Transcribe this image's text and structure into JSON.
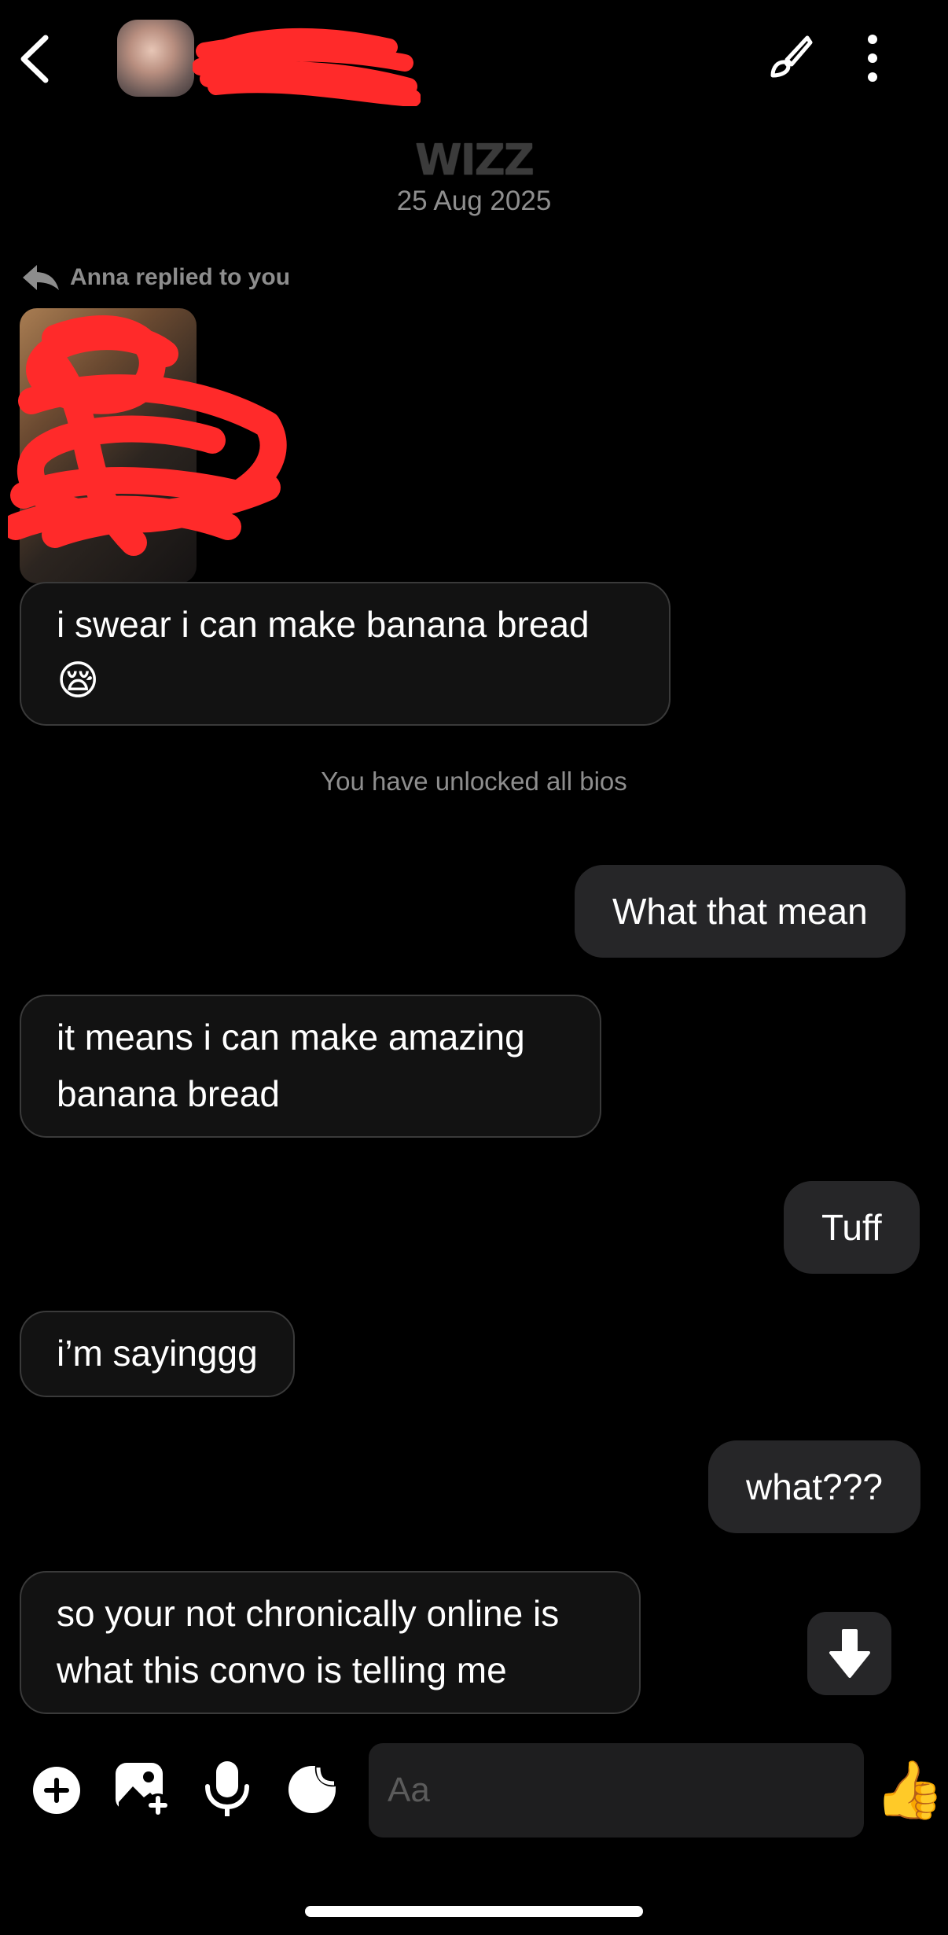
{
  "header": {
    "back_icon": "chevron-left-icon",
    "brush_icon": "paintbrush-icon",
    "more_icon": "vertical-ellipsis-icon"
  },
  "brand": "WIZZ",
  "date": "25 Aug 2025",
  "reply_note": "Anna replied to you",
  "messages": [
    {
      "side": "in",
      "text": "i swear i can make banana bread"
    },
    {
      "side": "system",
      "text": "You have unlocked all bios"
    },
    {
      "side": "out",
      "text": "What that mean"
    },
    {
      "side": "in",
      "text": "it means i can make amazing banana bread"
    },
    {
      "side": "out",
      "text": "Tuff"
    },
    {
      "side": "in",
      "text": "i’m sayinggg"
    },
    {
      "side": "out",
      "text": "what???"
    },
    {
      "side": "in",
      "text": "so your not chronically online is what this convo is telling me"
    }
  ],
  "emoji": {
    "first_message": "😪",
    "like": "👍"
  },
  "composer": {
    "placeholder": "Aa",
    "icons": [
      "plus-circle-icon",
      "image-add-icon",
      "microphone-icon",
      "sticker-icon"
    ]
  },
  "colors": {
    "background": "#000000",
    "incoming_bubble": "#121212",
    "outgoing_bubble": "#262628",
    "redaction": "#ff2a2a"
  }
}
